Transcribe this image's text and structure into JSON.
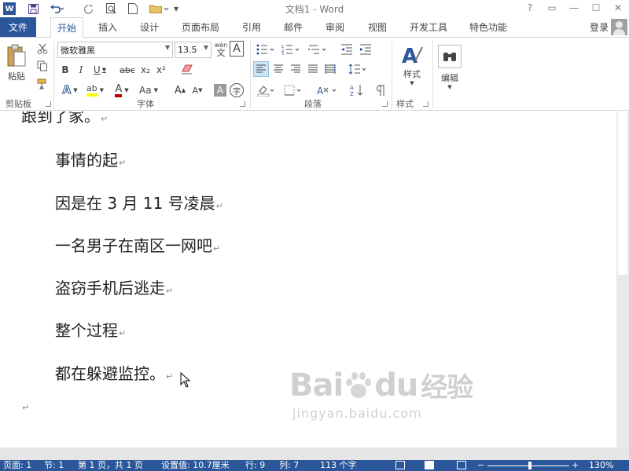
{
  "app": {
    "title": "文档1 - Word",
    "logo_letter": "W",
    "help": "?",
    "window_buttons": [
      "▭",
      "—",
      "☐",
      "✕"
    ]
  },
  "quick_access": {
    "save": "save-icon",
    "undo": "undo-icon",
    "redo": "redo-icon",
    "print_preview": "print-preview-icon",
    "new": "new-document-icon",
    "open": "open-folder-icon",
    "more": "▾"
  },
  "tabs": [
    {
      "label": "文件"
    },
    {
      "label": "开始",
      "active": true
    },
    {
      "label": "插入"
    },
    {
      "label": "设计"
    },
    {
      "label": "页面布局"
    },
    {
      "label": "引用"
    },
    {
      "label": "邮件"
    },
    {
      "label": "审阅"
    },
    {
      "label": "视图"
    },
    {
      "label": "开发工具"
    },
    {
      "label": "特色功能"
    }
  ],
  "account": {
    "login": "登录"
  },
  "ribbon": {
    "clipboard": {
      "label": "剪贴板",
      "paste": "粘贴"
    },
    "font": {
      "label": "字体",
      "font_name": "微软雅黑",
      "font_size": "13.5",
      "pinyin": "wén",
      "pinyin_char": "文",
      "char_border": "A",
      "bold": "B",
      "italic": "I",
      "underline": "U",
      "strikethrough": "abc",
      "subscript": "x₂",
      "superscript": "x²",
      "text_effects": "A",
      "highlight": "ab",
      "font_color": "A",
      "change_case": "Aa",
      "grow": "A",
      "shrink": "A",
      "char_shading": "A",
      "enclose": "字"
    },
    "paragraph": {
      "label": "段落"
    },
    "styles": {
      "label": "样式",
      "button": "样式"
    },
    "editing": {
      "button": "编辑"
    }
  },
  "document": {
    "lines": [
      "跟到了家。",
      "事情的起",
      "因是在 3 月 11 号凌晨",
      "一名男子在南区一网吧",
      "盗窃手机后逃走",
      "整个过程",
      "都在躲避监控。"
    ],
    "paragraph_mark": "↵"
  },
  "watermark": {
    "brand": "Bai",
    "brand_mid": "du",
    "brand_cn": "经验",
    "url": "jingyan.baidu.com"
  },
  "status_bar": {
    "page": "页面: 1",
    "section": "节: 1",
    "page_of": "第 1 页，共 1 页",
    "position": "设置值: 10.7厘米",
    "line": "行: 9",
    "column": "列: 7",
    "word_count": "113 个字",
    "zoom_minus": "−",
    "zoom_plus": "+",
    "zoom": "130%"
  },
  "colors": {
    "accent": "#2b579a",
    "highlight": "#ffff00",
    "font_color": "#c00000"
  }
}
